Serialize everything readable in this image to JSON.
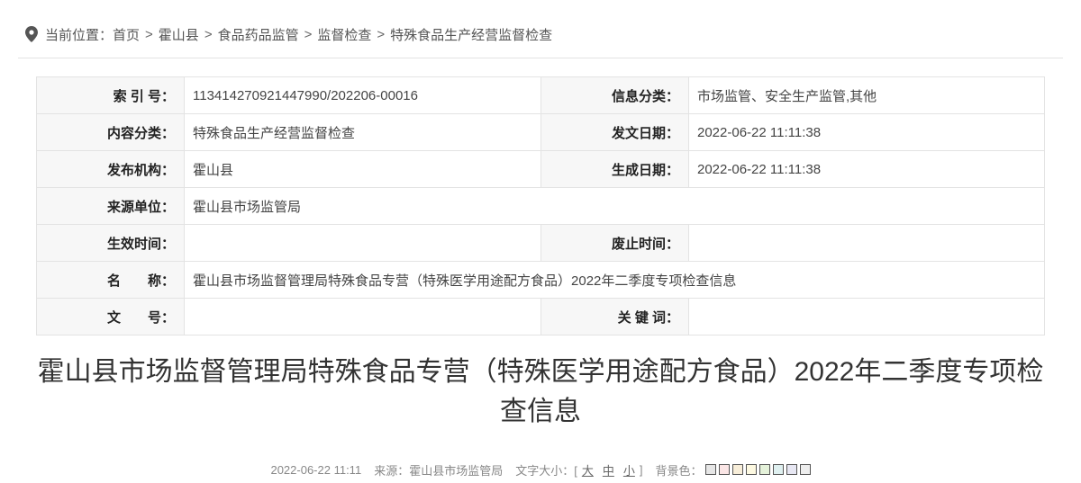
{
  "breadcrumb": {
    "prefix": "当前位置：",
    "items": [
      "首页",
      "霍山县",
      "食品药品监管",
      "监督检查",
      "特殊食品生产经营监督检查"
    ],
    "separator": ">"
  },
  "meta": {
    "index_label": "索 引 号：",
    "index_value": "113414270921447990/202206-00016",
    "info_cat_label": "信息分类：",
    "info_cat_value": "市场监管、安全生产监管,其他",
    "content_cat_label": "内容分类：",
    "content_cat_value": "特殊食品生产经营监督检查",
    "pub_date_label": "发文日期：",
    "pub_date_value": "2022-06-22 11:11:38",
    "publisher_label": "发布机构：",
    "publisher_value": "霍山县",
    "gen_date_label": "生成日期：",
    "gen_date_value": "2022-06-22 11:11:38",
    "source_label": "来源单位：",
    "source_value": "霍山县市场监管局",
    "effective_label": "生效时间：",
    "effective_value": "",
    "repeal_label": "废止时间：",
    "repeal_value": "",
    "name_label": "名　　称：",
    "name_value": "霍山县市场监督管理局特殊食品专营（特殊医学用途配方食品）2022年二季度专项检查信息",
    "doc_no_label": "文　　号：",
    "doc_no_value": "",
    "keywords_label": "关 键 词：",
    "keywords_value": ""
  },
  "article": {
    "title": "霍山县市场监督管理局特殊食品专营（特殊医学用途配方食品）2022年二季度专项检查信息"
  },
  "infobar": {
    "date": "2022-06-22 11:11",
    "source": "来源：霍山县市场监管局",
    "font_size_label": "文字大小：[",
    "size_large": "大",
    "size_medium": "中",
    "size_small": "小",
    "font_size_close": "]",
    "bg_color_label": "背景色：",
    "swatches": [
      "#e6e6e6",
      "#fbe6e6",
      "#f8eed9",
      "#fdf9e1",
      "#e5f2da",
      "#dff0f0",
      "#e7e7f3",
      "#eeeeee"
    ]
  },
  "icons": {
    "location": "location-pin-icon"
  }
}
